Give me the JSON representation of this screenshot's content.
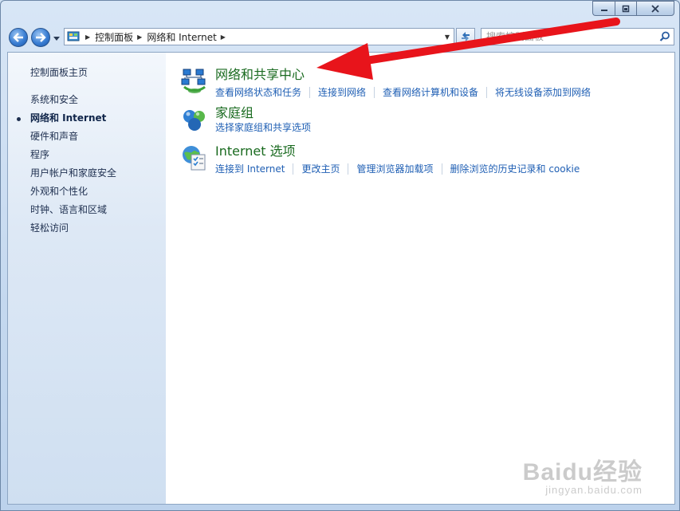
{
  "window": {
    "caption_buttons": {
      "minimize_icon": "minimize-icon",
      "maximize_icon": "restore-icon",
      "close_icon": "close-icon"
    }
  },
  "nav": {
    "breadcrumb": [
      "控制面板",
      "网络和 Internet"
    ],
    "search_placeholder": "搜索控制面板"
  },
  "sidebar": {
    "home_label": "控制面板主页",
    "items": [
      {
        "label": "系统和安全",
        "active": false
      },
      {
        "label": "网络和 Internet",
        "active": true
      },
      {
        "label": "硬件和声音",
        "active": false
      },
      {
        "label": "程序",
        "active": false
      },
      {
        "label": "用户帐户和家庭安全",
        "active": false
      },
      {
        "label": "外观和个性化",
        "active": false
      },
      {
        "label": "时钟、语言和区域",
        "active": false
      },
      {
        "label": "轻松访问",
        "active": false
      }
    ]
  },
  "categories": [
    {
      "title": "网络和共享中心",
      "icon": "network-sharing-icon",
      "links": [
        "查看网络状态和任务",
        "连接到网络",
        "查看网络计算机和设备",
        "将无线设备添加到网络"
      ]
    },
    {
      "title": "家庭组",
      "icon": "homegroup-icon",
      "links": [
        "选择家庭组和共享选项"
      ]
    },
    {
      "title": "Internet 选项",
      "icon": "internet-options-icon",
      "links": [
        "连接到 Internet",
        "更改主页",
        "管理浏览器加载项",
        "删除浏览的历史记录和 cookie"
      ]
    }
  ],
  "annotation": {
    "color": "#e8141b"
  },
  "watermark": {
    "main": "Baidu经验",
    "sub": "jingyan.baidu.com"
  },
  "colors": {
    "category_title": "#196a1f",
    "link": "#1f5fb4",
    "sidebar_text": "#1e2f4f"
  }
}
